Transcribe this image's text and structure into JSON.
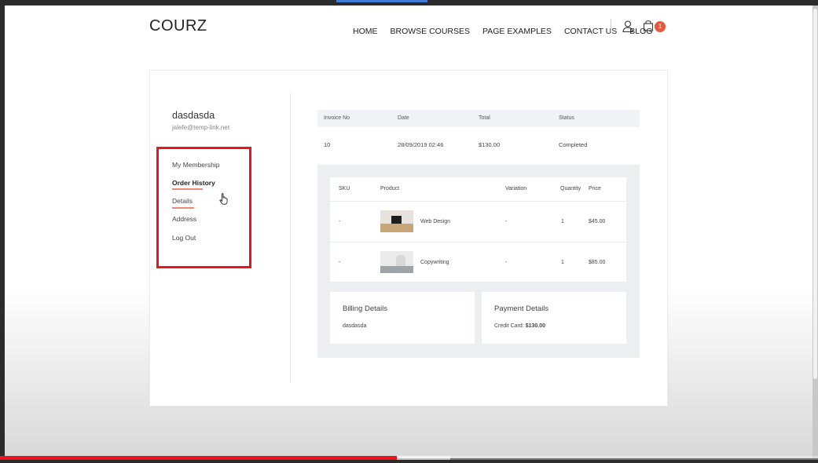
{
  "header": {
    "logo": "COURZ",
    "nav": [
      "HOME",
      "BROWSE COURSES",
      "PAGE EXAMPLES",
      "CONTACT US",
      "BLOG"
    ],
    "cart_count": "1",
    "icons": {
      "user": "user-icon",
      "cart": "cart-icon"
    }
  },
  "account": {
    "name": "dasdasda",
    "email": "jalefe@temp-link.net",
    "menu": [
      "My Membership",
      "Order History",
      "Details",
      "Address",
      "Log Out"
    ]
  },
  "orders": {
    "headers": [
      "Invoice No",
      "Date",
      "Total",
      "Status"
    ],
    "row": [
      "10",
      "28/09/2019 02:46",
      "$130.00",
      "Completed"
    ]
  },
  "items": {
    "headers": [
      "SKU",
      "Product",
      "Variation",
      "Quantity",
      "Price"
    ],
    "rows": [
      {
        "sku": "-",
        "product": "Web Design",
        "variation": "-",
        "quantity": "1",
        "price": "$45.00"
      },
      {
        "sku": "-",
        "product": "Copywriting",
        "variation": "-",
        "quantity": "1",
        "price": "$85.00"
      }
    ]
  },
  "billing": {
    "title": "Billing Details",
    "name": "dasdasda"
  },
  "payment": {
    "title": "Payment Details",
    "label": "Credit Card:",
    "amount": "$130.00"
  },
  "video": {
    "played_fraction": 0.485,
    "buffered_fraction": 0.55
  },
  "colors": {
    "accent": "#e8573f",
    "highlight": "#e8161c",
    "progress": "#e8161c",
    "underline": "#e98a72"
  }
}
